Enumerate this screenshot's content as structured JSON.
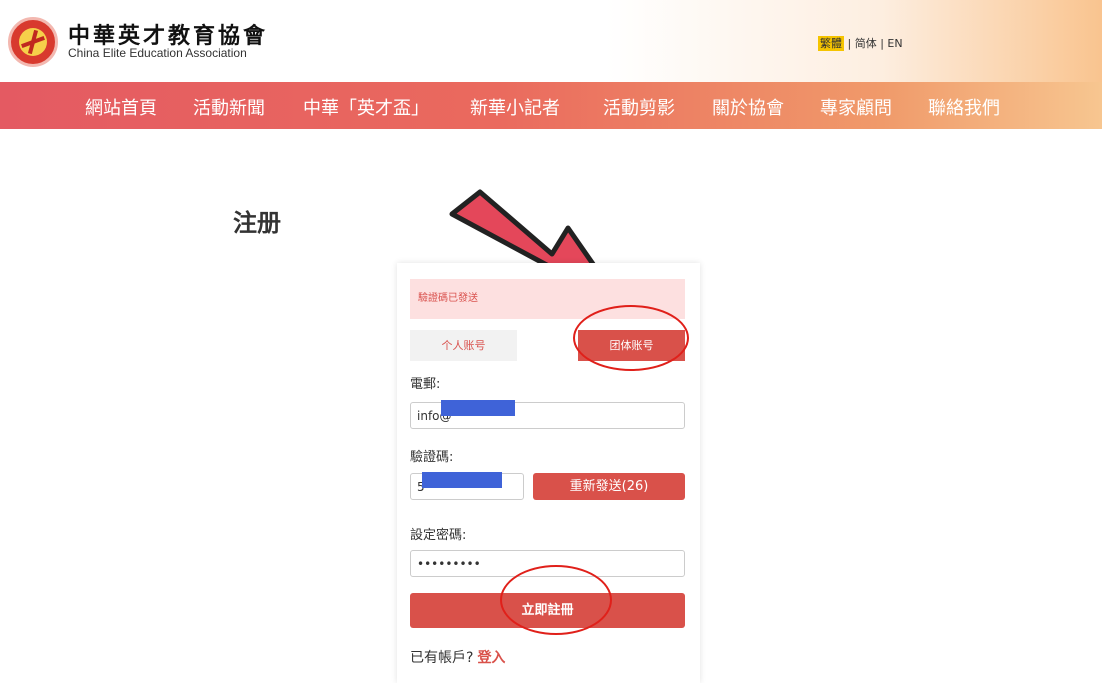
{
  "header": {
    "org_name_cn": "中華英才教育協會",
    "org_name_en": "China Elite Education Association",
    "lang_traditional": "繁體",
    "lang_rest": " | 简体 | EN"
  },
  "nav": {
    "items": [
      "網站首頁",
      "活動新聞",
      "中華「英才盃」",
      "新華小記者",
      "活動剪影",
      "關於協會",
      "專家顧問",
      "聯絡我們"
    ]
  },
  "page": {
    "title": "注册"
  },
  "form": {
    "alert": "驗證碼已發送",
    "tab_personal": "个人账号",
    "tab_group": "团体账号",
    "email_label": "電郵:",
    "email_value": "info@",
    "code_label": "驗證碼:",
    "code_value": "5",
    "resend_label": "重新發送(26)",
    "password_label": "設定密碼:",
    "password_value": "•••••••••",
    "submit_label": "立即註冊",
    "login_prompt": "已有帳戶?",
    "login_link": "登入"
  },
  "colors": {
    "brand_red": "#d9514a",
    "nav_gradient_start": "#e45a62",
    "nav_gradient_end": "#f7c690",
    "annotation_red": "#e0201a",
    "redaction_blue": "#3f63d8"
  }
}
